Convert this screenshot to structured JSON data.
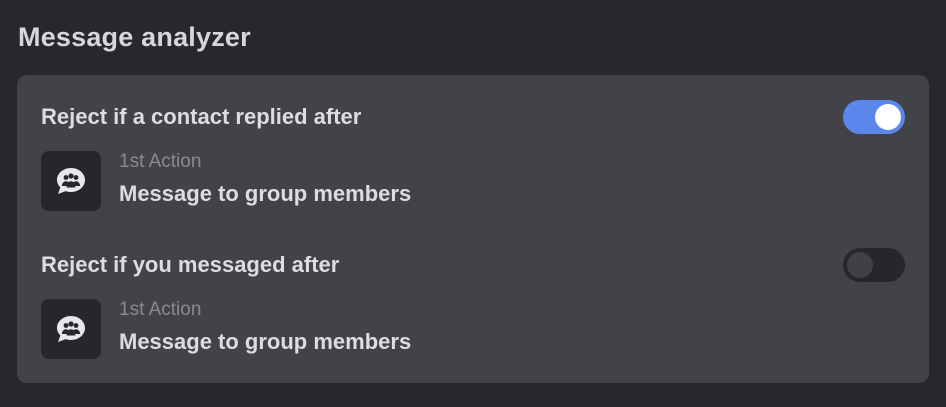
{
  "section": {
    "title": "Message analyzer"
  },
  "rules": [
    {
      "title": "Reject if a contact replied after",
      "enabled": true,
      "action": {
        "step": "1st Action",
        "description": "Message to group members",
        "icon": "group-chat-icon"
      }
    },
    {
      "title": "Reject if you messaged after",
      "enabled": false,
      "action": {
        "step": "1st Action",
        "description": "Message to group members",
        "icon": "group-chat-icon"
      }
    }
  ],
  "colors": {
    "page_background": "#27282d",
    "card_background": "#424349",
    "toggle_on": "#5b86ea",
    "toggle_off": "#26272b"
  }
}
